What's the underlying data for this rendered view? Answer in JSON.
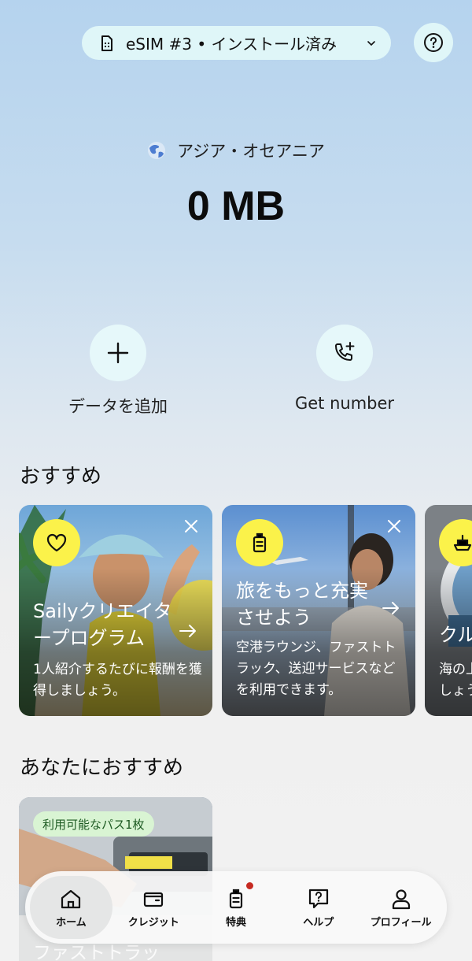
{
  "header": {
    "esim_label": "eSIM #3 • インストール済み",
    "esim_icon": "sim-card-icon",
    "help_icon": "help-circle-icon"
  },
  "plan": {
    "region": "アジア・オセアニア",
    "data_remaining": "0 MB"
  },
  "actions": [
    {
      "label": "データを追加",
      "icon": "plus-icon"
    },
    {
      "label": "Get number",
      "icon": "phone-plus-icon"
    }
  ],
  "recommended": {
    "title": "おすすめ",
    "cards": [
      {
        "title": "Sailyクリエイタープログラム",
        "description": "1人紹介するたびに報酬を獲得しましょう。",
        "icon": "heart-icon"
      },
      {
        "title": "旅をもっと充実させよう",
        "description": "空港ラウンジ、ファストトラック、送迎サービスなどを利用できます。",
        "icon": "luggage-icon"
      },
      {
        "title": "クル",
        "description": "海の上でもつながっていましょう",
        "icon": "ship-icon"
      }
    ]
  },
  "for_you": {
    "title": "あなたにおすすめ",
    "badge": "利用可能なパス1枚",
    "card_title": "ファストトラッ"
  },
  "nav": [
    {
      "label": "ホーム",
      "icon": "home-icon",
      "active": true
    },
    {
      "label": "クレジット",
      "icon": "wallet-icon"
    },
    {
      "label": "特典",
      "icon": "luggage-icon",
      "notification": true
    },
    {
      "label": "ヘルプ",
      "icon": "help-bubble-icon"
    },
    {
      "label": "プロフィール",
      "icon": "profile-icon"
    }
  ],
  "colors": {
    "accent_yellow": "#fbf24a",
    "pill_background": "#dff6f8",
    "badge_green": "#d9f4d3",
    "notification_red": "#c62a22"
  }
}
